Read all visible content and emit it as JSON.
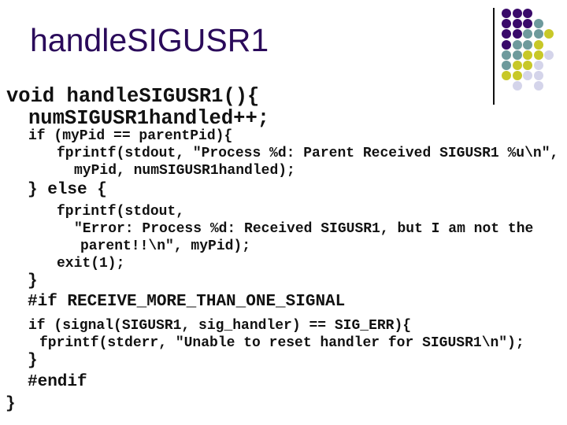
{
  "slide": {
    "title": "handleSIGUSR1",
    "code_lines": [
      "void handleSIGUSR1(){",
      "numSIGUSR1handled++;",
      "if (myPid == parentPid){",
      "fprintf(stdout, \"Process %d: Parent Received SIGUSR1 %u\\n\",",
      "myPid, numSIGUSR1handled);",
      "} else {",
      "fprintf(stdout,",
      "\"Error: Process %d: Received SIGUSR1, but I am not the",
      "parent!!\\n\", myPid);",
      "exit(1);",
      "}",
      "#if RECEIVE_MORE_THAN_ONE_SIGNAL",
      "if (signal(SIGUSR1, sig_handler) == SIG_ERR){",
      "fprintf(stderr, \"Unable to reset handler for SIGUSR1\\n\");",
      "}",
      "#endif",
      "}"
    ]
  },
  "decoration": {
    "colors": {
      "P": "#3a0a6a",
      "T": "#6e9a9c",
      "Y": "#c8c828",
      "L": "#d4d4ea"
    },
    "dot_grid": [
      "PPP..",
      "PPPT.",
      "PPTTY",
      "PTTY.",
      "TTYYL",
      "TYYL.",
      "YYLL.",
      ".L.L."
    ]
  }
}
